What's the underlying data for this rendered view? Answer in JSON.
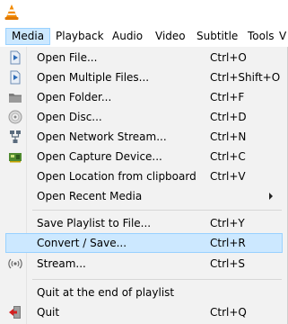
{
  "menubar": {
    "items": [
      "Media",
      "Playback",
      "Audio",
      "Video",
      "Subtitle",
      "Tools",
      "V"
    ]
  },
  "media_menu": {
    "items": [
      {
        "label": "Open File...",
        "shortcut": "Ctrl+O",
        "icon": "file-play-icon"
      },
      {
        "label": "Open Multiple Files...",
        "shortcut": "Ctrl+Shift+O",
        "icon": "file-play-icon"
      },
      {
        "label": "Open Folder...",
        "shortcut": "Ctrl+F",
        "icon": "folder-icon"
      },
      {
        "label": "Open Disc...",
        "shortcut": "Ctrl+D",
        "icon": "disc-icon"
      },
      {
        "label": "Open Network Stream...",
        "shortcut": "Ctrl+N",
        "icon": "network-icon"
      },
      {
        "label": "Open Capture Device...",
        "shortcut": "Ctrl+C",
        "icon": "capture-card-icon"
      },
      {
        "label": "Open Location from clipboard",
        "shortcut": "Ctrl+V",
        "icon": ""
      },
      {
        "label": "Open Recent Media",
        "shortcut": "",
        "icon": "",
        "submenu": true
      },
      {
        "label": "Save Playlist to File...",
        "shortcut": "Ctrl+Y",
        "icon": ""
      },
      {
        "label": "Convert / Save...",
        "shortcut": "Ctrl+R",
        "icon": "",
        "highlighted": true
      },
      {
        "label": "Stream...",
        "shortcut": "Ctrl+S",
        "icon": "stream-icon"
      },
      {
        "label": "Quit at the end of playlist",
        "shortcut": "",
        "icon": ""
      },
      {
        "label": "Quit",
        "shortcut": "Ctrl+Q",
        "icon": "quit-icon"
      }
    ]
  },
  "colors": {
    "highlight": "#cce8ff",
    "highlight_border": "#99d1ff",
    "cone_orange": "#f28a00"
  }
}
